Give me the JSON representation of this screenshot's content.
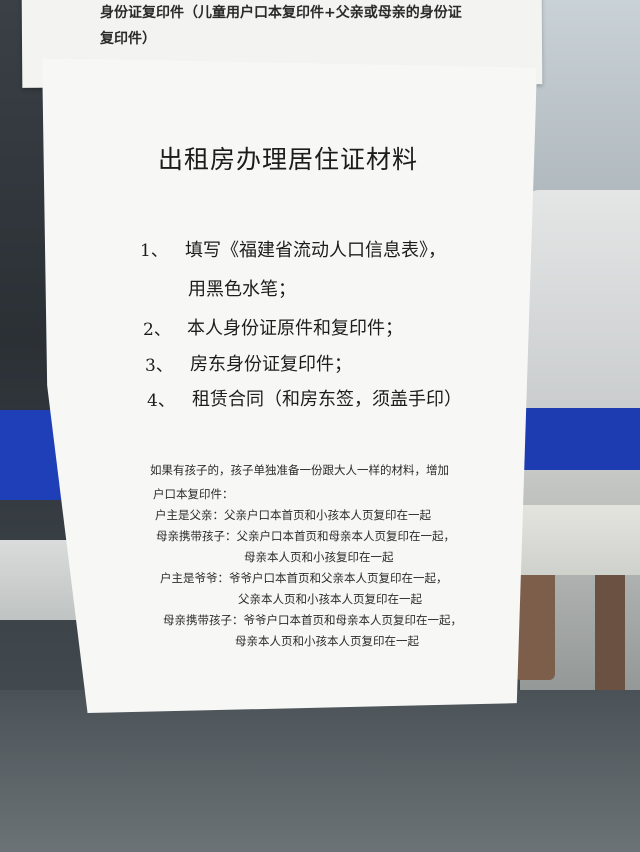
{
  "top_notice": {
    "line1": "身份证复印件（儿童用户口本复印件+父亲或母亲的身份证",
    "line2": "复印件）"
  },
  "notice": {
    "title": "出租房办理居住证材料",
    "items": [
      {
        "num": "1、",
        "text": "填写《福建省流动人口信息表》，",
        "text2": "用黑色水笔；"
      },
      {
        "num": "2、",
        "text": "本人身份证原件和复印件；"
      },
      {
        "num": "3、",
        "text": "房东身份证复印件；"
      },
      {
        "num": "4、",
        "text": "租赁合同（和房东签，须盖手印）"
      }
    ],
    "notes": [
      "如果有孩子的，孩子单独准备一份跟大人一样的材料，增加",
      "户口本复印件：",
      "户主是父亲：父亲户口本首页和小孩本人页复印在一起",
      "母亲携带孩子：父亲户口本首页和母亲本人页复印在一起，",
      "母亲本人页和小孩复印在一起",
      "户主是爷爷：爷爷户口本首页和父亲本人页复印在一起，",
      "父亲本人页和小孩本人页复印在一起",
      "母亲携带孩子：爷爷户口本首页和母亲本人页复印在一起，",
      "母亲本人页和小孩本人页复印在一起"
    ]
  }
}
